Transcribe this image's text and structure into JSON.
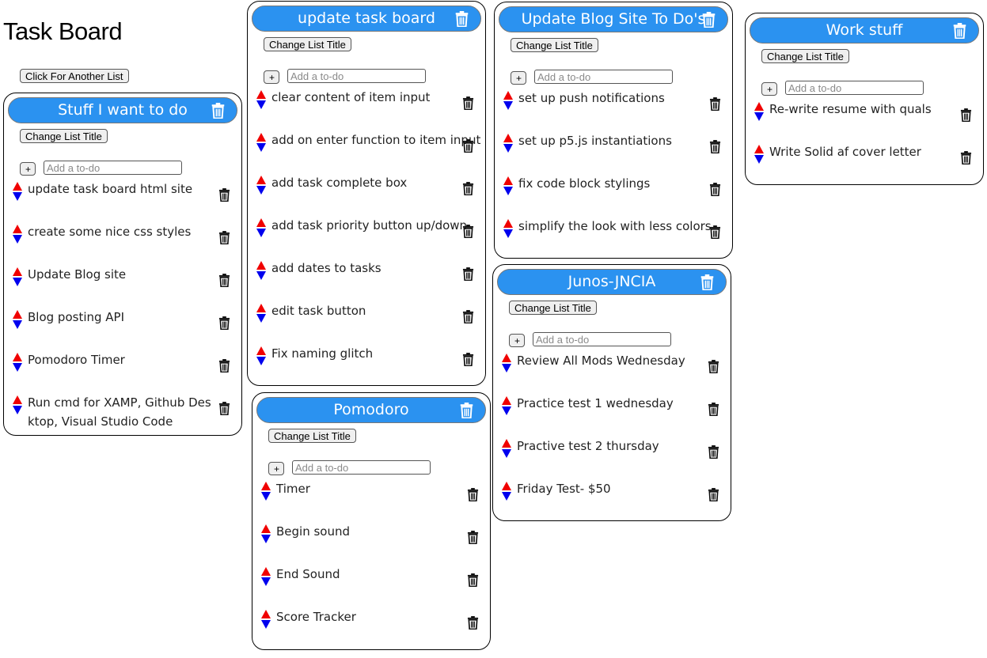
{
  "page": {
    "title": "Task Board",
    "new_list_button": "Click For Another List"
  },
  "labels": {
    "change_title": "Change List Title",
    "add_button": "+",
    "add_placeholder": "Add a to-do"
  },
  "icons": {
    "delete": "trash-icon",
    "move_up": "arrow-up-icon",
    "move_down": "arrow-down-icon"
  },
  "colors": {
    "header_bg": "#2b92f0",
    "arrow_up": "#f00000",
    "arrow_down": "#0000ee"
  },
  "lists": [
    {
      "title": "Stuff I want to do",
      "tasks": [
        "update task board html site",
        "create some nice css styles",
        "Update Blog site",
        "Blog posting API",
        "Pomodoro Timer",
        "Run cmd for XAMP, Github Desktop, Visual Studio Code"
      ]
    },
    {
      "title": "update task board",
      "tasks": [
        "clear content of item input",
        "add on enter function to item input",
        "add task complete box",
        "add task priority button up/down",
        "add dates to tasks",
        "edit task button",
        "Fix naming glitch"
      ]
    },
    {
      "title": "Pomodoro",
      "tasks": [
        "Timer",
        "Begin sound",
        "End Sound",
        "Score Tracker"
      ]
    },
    {
      "title": "Update Blog Site To Do's",
      "tasks": [
        "set up push notifications",
        "set up p5.js instantiations",
        "fix code block stylings",
        "simplify the look with less colors"
      ]
    },
    {
      "title": "Junos-JNCIA",
      "tasks": [
        "Review All Mods Wednesday",
        "Practice test 1 wednesday",
        "Practive test 2 thursday",
        "Friday Test- $50"
      ]
    },
    {
      "title": "Work stuff",
      "tasks": [
        "Re-write resume with quals",
        "Write Solid af cover letter"
      ]
    }
  ]
}
